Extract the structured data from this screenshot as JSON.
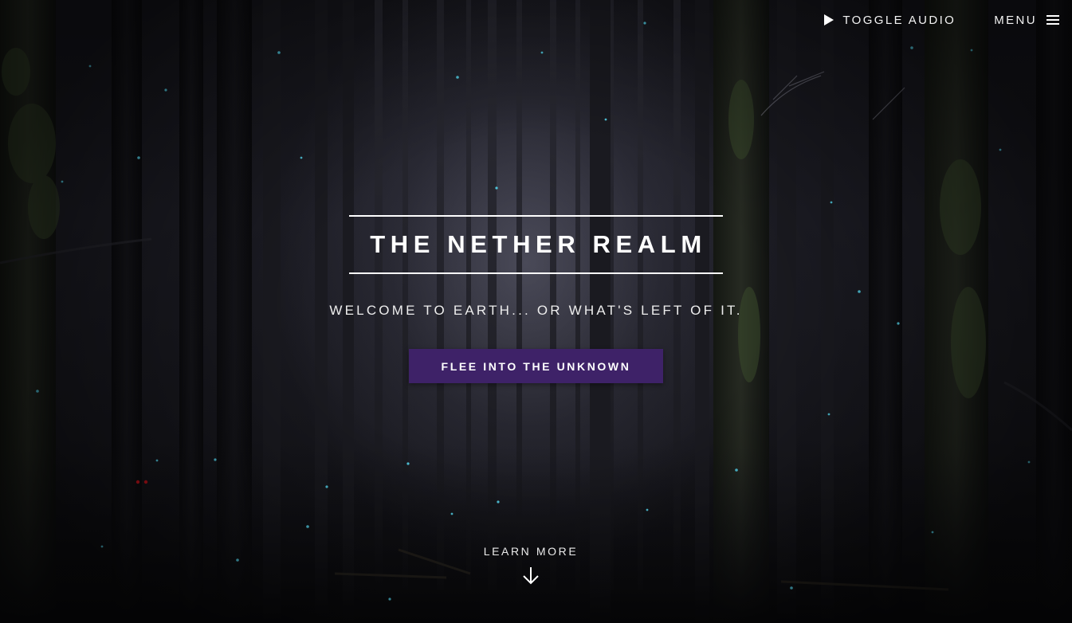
{
  "nav": {
    "audio_label": "TOGGLE AUDIO",
    "audio_icon": "play-icon",
    "menu_label": "MENU",
    "menu_icon": "hamburger-menu-icon"
  },
  "hero": {
    "title": "THE NETHER REALM",
    "tagline": "WELCOME TO EARTH... OR WHAT'S LEFT OF IT.",
    "cta_label": "FLEE INTO THE UNKNOWN",
    "learn_more_label": "LEARN MORE",
    "learn_more_icon": "arrow-down-icon"
  },
  "colors": {
    "cta_background": "#3e2268",
    "text": "#ffffff",
    "firefly": "#4fc3d9",
    "eyes": "#c0121a",
    "background": "#16161c"
  }
}
